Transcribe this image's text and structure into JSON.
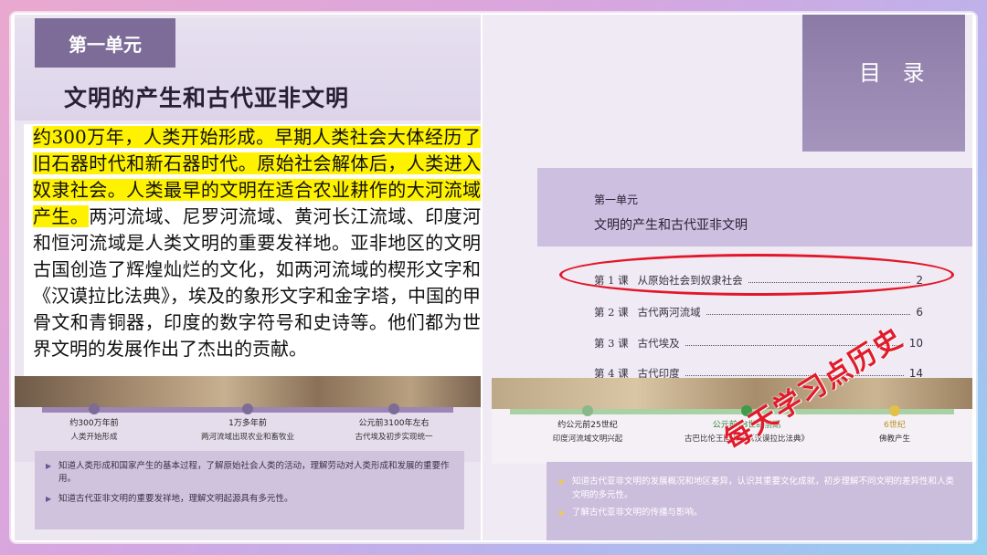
{
  "left_page": {
    "unit_label": "第一单元",
    "title": "文明的产生和古代亚非文明",
    "intro_highlighted": "约300万年，人类开始形成。早期人类社会大体经历了旧石器时代和新石器时代。原始社会解体后，人类进入奴隶社会。人类最早的文明在适合农业耕作的大河流域产生。",
    "intro_rest": "两河流域、尼罗河流域、黄河长江流域、印度河和恒河流域是人类文明的重要发祥地。亚非地区的文明古国创造了辉煌灿烂的文化，如两河流域的楔形文字和《汉谟拉比法典》，埃及的象形文字和金字塔，中国的甲骨文和青铜器，印度的数字符号和史诗等。他们都为世界文明的发展作出了杰出的贡献。",
    "timeline": [
      {
        "date": "约300万年前",
        "event": "人类开始形成"
      },
      {
        "date": "1万多年前",
        "event": "两河流域出现农业和畜牧业"
      },
      {
        "date": "公元前3100年左右",
        "event": "古代埃及初步实现统一"
      }
    ],
    "goals": [
      "知道人类形成和国家产生的基本过程，了解原始社会人类的活动，理解劳动对人类形成和发展的重要作用。",
      "知道古代亚非文明的重要发祥地，理解文明起源具有多元性。"
    ]
  },
  "right_page": {
    "catalog_label": "目 录",
    "unit_label": "第一单元",
    "unit_title": "文明的产生和古代亚非文明",
    "toc": [
      {
        "num": "第 1 课",
        "name": "从原始社会到奴隶社会",
        "page": "2"
      },
      {
        "num": "第 2 课",
        "name": "古代两河流域",
        "page": "6"
      },
      {
        "num": "第 3 课",
        "name": "古代埃及",
        "page": "10"
      },
      {
        "num": "第 4 课",
        "name": "古代印度",
        "page": "14"
      }
    ],
    "timeline": [
      {
        "date": "约公元前25世纪",
        "event": "印度河流域文明兴起"
      },
      {
        "date": "公元前18世纪前期",
        "event": "古巴比伦王国颁布《汉谟拉比法典》"
      },
      {
        "date": "6世纪",
        "event": "佛教产生"
      }
    ],
    "goals": [
      "知道古代亚非文明的发展概况和地区差异，认识其重要文化成就，初步理解不同文明的差异性和人类文明的多元性。",
      "了解古代亚非文明的传播与影响。"
    ]
  },
  "watermark": "每天学习点历史",
  "colors": {
    "highlight": "#fff200",
    "oval": "#e3172a",
    "accent": "#7d6b98"
  }
}
